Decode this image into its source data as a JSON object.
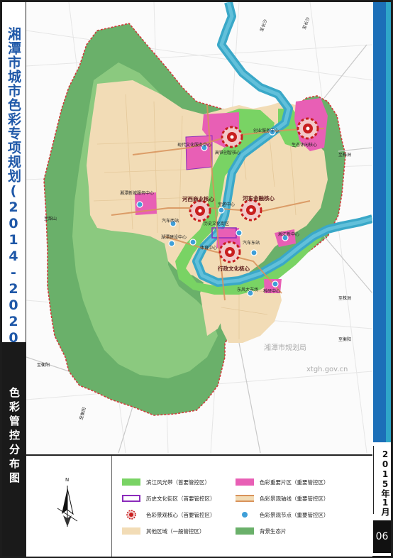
{
  "title": "湘潭市城市色彩专项规划(2014-2020)",
  "subtitle": "色彩管控分布图",
  "date": "2015年1月",
  "page_number": "06",
  "colors": {
    "accent_blue": "#1c6fb8",
    "accent_cyan": "#2fa6c9",
    "river": "#3aa8c8",
    "core_area": "#e85fb5",
    "riverside_green": "#79d364",
    "other_area": "#f2dcb6",
    "ecology": "#6ab06a",
    "boundary": "#d23b3b"
  },
  "legend": {
    "items": [
      {
        "label": "滨江风光带（首要管控区）",
        "symbol": "green-fill"
      },
      {
        "label": "历史文化街区（首要管控区）",
        "symbol": "purple-outline"
      },
      {
        "label": "色彩景观核心（首要管控区）",
        "symbol": "red-core"
      },
      {
        "label": "其他区域（一般管控区）",
        "symbol": "beige-fill"
      },
      {
        "label": "色彩重要片区（重要管控区）",
        "symbol": "magenta-fill"
      },
      {
        "label": "色彩景观轴线（重要管控区）",
        "symbol": "axis-line"
      },
      {
        "label": "色彩景观节点（重要管控区）",
        "symbol": "blue-dot"
      },
      {
        "label": "背景生态片",
        "symbol": "dark-green-fill"
      }
    ]
  },
  "map_labels": {
    "creative_center": "创业服务中心",
    "ecology_center": "生态休闲核心",
    "modern_culture": "现代文化服务中心",
    "hightech_core": "高铁创智核心",
    "hexi_newtown": "湘潭新城服务中心",
    "hexi_business": "河西商业核心",
    "river_node": "宝塔中心",
    "hedong_business": "河东金融核心",
    "bus_station": "汽车西站",
    "history_culture": "历史文化街区",
    "bus_east": "汽车东站",
    "univ_center": "湖潭建设中心",
    "sports_center": "体育中心",
    "gov_core": "行政文化核心",
    "east_node": "湘江新中心",
    "dongfeng": "东风大市场",
    "tech_center": "科研中心",
    "north_road_1": "至长沙",
    "north_road_2": "至长沙",
    "east_road": "至株洲",
    "east_road_2": "至株洲",
    "south_road": "至衡阳",
    "southwest_road": "至衡阳",
    "southeast_road": "至衡阳",
    "west_road": "至韶山"
  },
  "watermark": {
    "line1": "湘潭市规划局",
    "line2": "xtgh.gov.cn"
  },
  "compass_label": "N"
}
